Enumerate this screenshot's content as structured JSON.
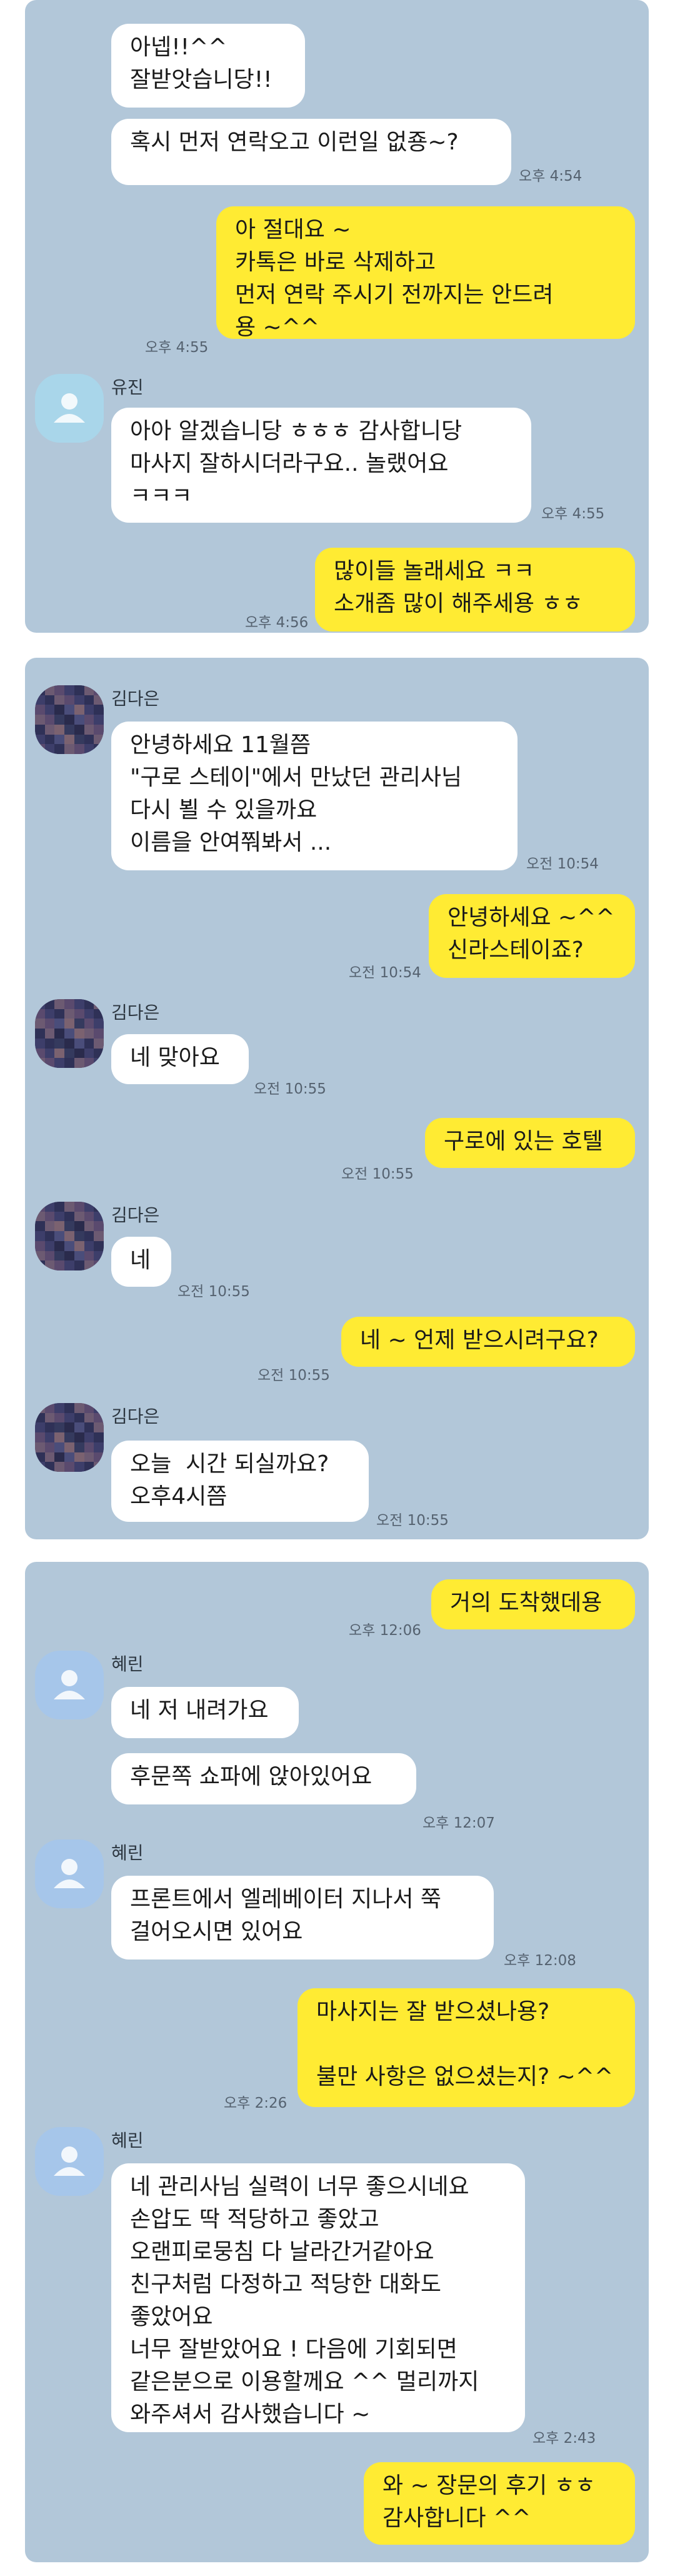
{
  "panel1": {
    "messages": [
      {
        "text": "아넵!!^^\n잘받앗습니당!!"
      },
      {
        "text": "혹시 먼저 연락오고 이런일 없죵~?",
        "time": "오후 4:54"
      },
      {
        "text": "아 절대요 ~\n카톡은 바로 삭제하고\n먼저 연락 주시기 전까지는 안드려\n용 ~^^",
        "time": "오후 4:55"
      },
      {
        "sender": "유진",
        "text": "아아 알겠습니당 ㅎㅎㅎ 감사합니당\n마사지 잘하시더라구요.. 놀랬어요\nㅋㅋㅋ",
        "time": "오후 4:55"
      },
      {
        "text": "많이들 놀래세요 ㅋㅋ\n소개좀 많이 해주세용 ㅎㅎ",
        "time": "오후 4:56"
      }
    ]
  },
  "panel2": {
    "messages": [
      {
        "sender": "김다은",
        "text": "안녕하세요 11월쯤\n\"구로 스테이\"에서 만났던 관리사님\n다시 뵐 수 있을까요\n이름을 안여쭤봐서 ...",
        "time": "오전 10:54"
      },
      {
        "text": "안녕하세요 ~^^\n신라스테이죠?",
        "time": "오전 10:54"
      },
      {
        "sender": "김다은",
        "text": "네 맞아요",
        "time": "오전 10:55"
      },
      {
        "text": "구로에 있는 호텔",
        "time": "오전 10:55"
      },
      {
        "sender": "김다은",
        "text": "네",
        "time": "오전 10:55"
      },
      {
        "text": "네 ~ 언제 받으시려구요?",
        "time": "오전 10:55"
      },
      {
        "sender": "김다은",
        "text": "오늘  시간 되실까요?\n오후4시쯤",
        "time": "오전 10:55"
      }
    ]
  },
  "panel3": {
    "messages": [
      {
        "text": "거의 도착했데용",
        "time": "오후 12:06"
      },
      {
        "sender": "혜린",
        "text": "네 저 내려가요"
      },
      {
        "text": "후문쪽 쇼파에 앉아있어요",
        "time": "오후 12:07"
      },
      {
        "sender": "혜린",
        "text": "프론트에서 엘레베이터 지나서 쭉\n걸어오시면 있어요",
        "time": "오후 12:08"
      },
      {
        "text": "마사지는 잘 받으셨나용?\n\n불만 사항은 없으셨는지? ~^^",
        "time": "오후 2:26"
      },
      {
        "sender": "혜린",
        "text": "네 관리사님 실력이 너무 좋으시네요\n손압도 딱 적당하고 좋았고\n오랜피로뭉침 다 날라간거같아요\n친구처럼 다정하고 적당한 대화도\n좋았어요\n너무 잘받았어요 ! 다음에 기회되면\n같은분으로 이용할께요 ^^ 멀리까지\n와주셔서 감사했습니다 ~",
        "time": "오후 2:43"
      },
      {
        "text": "와 ~ 장문의 후기 ㅎㅎ\n감사합니다 ^^"
      }
    ]
  },
  "colors": {
    "chat_bg": "#b2c7d9",
    "my_bubble": "#ffeb33",
    "their_bubble": "#ffffff"
  },
  "icons": {
    "default_avatar": "person-silhouette-icon",
    "photo_avatar": "pixelated-profile-photo"
  }
}
